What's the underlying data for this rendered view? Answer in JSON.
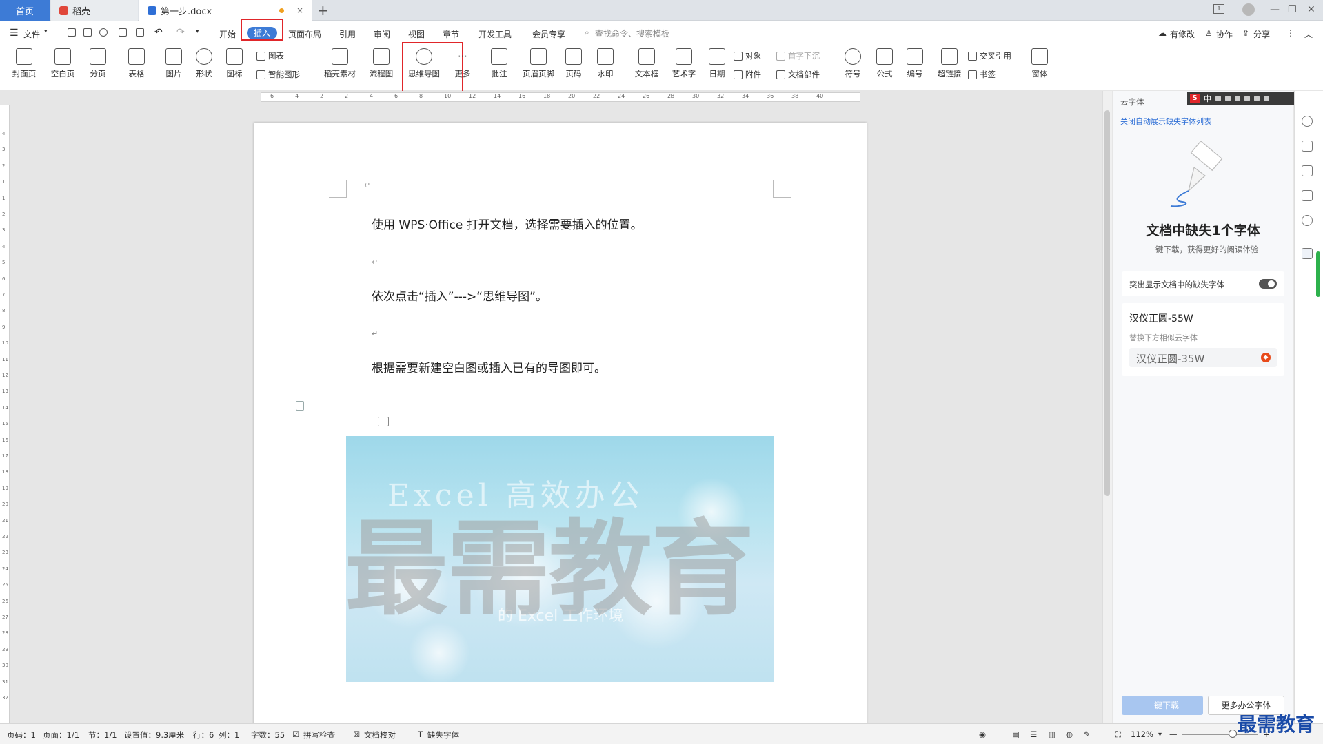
{
  "tabs": {
    "home": "首页",
    "daoke": "稻壳",
    "doc": "第一步.docx",
    "close_symbol": "×",
    "new_tab_symbol": "+"
  },
  "window": {
    "tab_count_badge": "1",
    "minimize": "—",
    "restore": "❐",
    "close": "✕"
  },
  "menu": {
    "file": "文件",
    "items": [
      "开始",
      "插入",
      "页面布局",
      "引用",
      "审阅",
      "视图",
      "章节",
      "开发工具",
      "会员专享"
    ],
    "active": "插入",
    "search_placeholder": "查找命令、搜索模板",
    "right": [
      "有修改",
      "协作",
      "分享"
    ]
  },
  "ribbon": {
    "buttons": [
      "封面页",
      "空白页",
      "分页",
      "表格",
      "图片",
      "形状",
      "图标",
      "稻壳素材",
      "流程图",
      "思维导图",
      "更多",
      "批注",
      "页眉页脚",
      "页码",
      "水印",
      "文本框",
      "艺术字",
      "日期",
      "符号",
      "公式",
      "编号",
      "超链接",
      "窗体"
    ],
    "small": {
      "chart": "图表",
      "smart_graphic": "智能图形",
      "object": "对象",
      "drop_cap": "首字下沉",
      "attachment": "附件",
      "doc_parts": "文档部件",
      "cross_ref": "交叉引用",
      "bookmark": "书签"
    }
  },
  "ruler": {
    "marks": [
      "6",
      "4",
      "2",
      "2",
      "4",
      "6",
      "8",
      "10",
      "12",
      "14",
      "16",
      "18",
      "20",
      "22",
      "24",
      "26",
      "28",
      "30",
      "32",
      "34",
      "36",
      "38",
      "40"
    ],
    "vmarks": [
      "4",
      "3",
      "2",
      "1",
      "1",
      "2",
      "3",
      "4",
      "5",
      "6",
      "7",
      "8",
      "9",
      "10",
      "11",
      "12",
      "13",
      "14",
      "15",
      "16",
      "17",
      "18",
      "19",
      "20",
      "21",
      "22",
      "23",
      "24",
      "25",
      "26",
      "27",
      "28",
      "29",
      "30",
      "31",
      "32"
    ]
  },
  "document": {
    "paragraphs": [
      "使用 WPS·Office 打开文档，选择需要插入的位置。",
      "依次点击“插入”--->“思维导图”。",
      "根据需要新建空白图或插入已有的导图即可。"
    ],
    "para_mark": "↵",
    "image": {
      "line1": "Excel 高效办公",
      "line2": "的 Excel 工作环境"
    },
    "watermark": "最需教育"
  },
  "panel": {
    "title": "云字体",
    "close_link": "关闭自动展示缺失字体列表",
    "heading": "文档中缺失1个字体",
    "subheading": "一键下载，获得更好的阅读体验",
    "highlight_label": "突出显示文档中的缺失字体",
    "missing_font": "汉仪正圆-55W",
    "replace_hint": "替换下方相似云字体",
    "alt_font": "汉仪正圆-35W",
    "download_btn": "一键下载",
    "more_btn": "更多办公字体"
  },
  "ime": {
    "logo": "S",
    "lang": "中"
  },
  "status": {
    "page_no": "页码：1",
    "pages": "页面：1/1",
    "section": "节：1/1",
    "setting": "设置值：9.3厘米",
    "row": "行：6",
    "col": "列：1",
    "words": "字数：55",
    "spell": "拼写检查",
    "proof": "文档校对",
    "missing_font": "缺失字体",
    "zoom": "112%",
    "zoom_minus": "—",
    "zoom_plus": "+"
  },
  "brand_watermark": "最需教育",
  "colors": {
    "accent": "#3d7bd6",
    "highlight_box": "#e0262a",
    "link": "#2f6fd6",
    "download_disabled": "#a8c6f0"
  }
}
